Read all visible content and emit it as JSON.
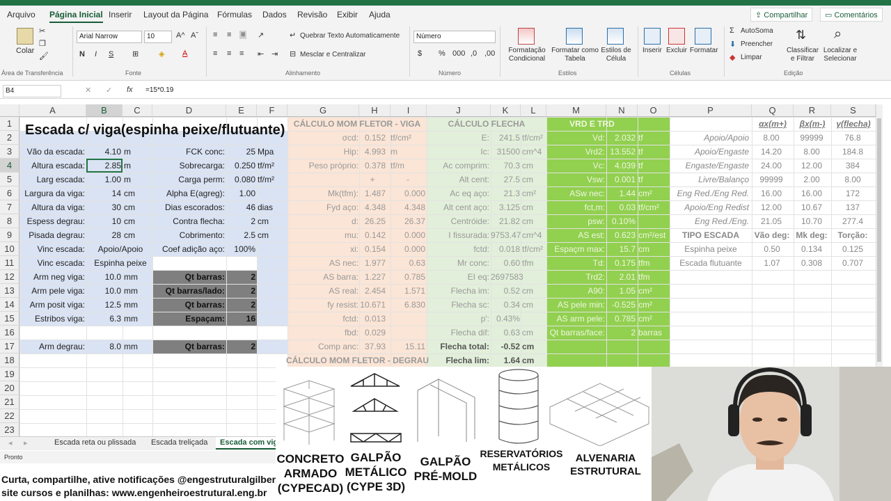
{
  "menu": {
    "items": [
      "Arquivo",
      "Página Inicial",
      "Inserir",
      "Layout da Página",
      "Fórmulas",
      "Dados",
      "Revisão",
      "Exibir",
      "Ajuda"
    ],
    "share": "Compartilhar",
    "comments": "Comentários"
  },
  "ribbon": {
    "paste": "Colar",
    "font_name": "Arial Narrow",
    "font_size": "10",
    "bold": "N",
    "italic": "I",
    "underline": "S",
    "wrap_text": "Quebrar Texto Automaticamente",
    "merge_center": "Mesclar e Centralizar",
    "number_format": "Número",
    "cond_format": "Formatação Condicional",
    "format_table": "Formatar como Tabela",
    "cell_styles": "Estilos de Célula",
    "insert": "Inserir",
    "delete": "Excluir",
    "format": "Formatar",
    "autosum": "AutoSoma",
    "fill": "Preencher",
    "clear": "Limpar",
    "sort_filter": "Classificar e Filtrar",
    "find_select": "Localizar e Selecionar",
    "groups": {
      "clipboard": "Área de Transferência",
      "font": "Fonte",
      "alignment": "Alinhamento",
      "number": "Número",
      "styles": "Estilos",
      "cells": "Células",
      "editing": "Edição"
    }
  },
  "formula_bar": {
    "name_box": "B4",
    "formula": "=15*0.19"
  },
  "columns": [
    "A",
    "B",
    "C",
    "D",
    "E",
    "F",
    "G",
    "H",
    "I",
    "J",
    "K",
    "L",
    "M",
    "N",
    "O",
    "P",
    "Q",
    "R",
    "S"
  ],
  "rows": [
    "1",
    "2",
    "3",
    "4",
    "5",
    "6",
    "7",
    "8",
    "9",
    "10",
    "11",
    "12",
    "13",
    "14",
    "15",
    "16",
    "17",
    "18",
    "19",
    "20",
    "21",
    "22",
    "23"
  ],
  "title": "Escada c/ viga(espinha peixe/flutuante)",
  "left_params": [
    {
      "label": "Vão da escada:",
      "value": "4.10",
      "unit": "m"
    },
    {
      "label": "Altura escada:",
      "value": "2.85",
      "unit": "m"
    },
    {
      "label": "Larg escada:",
      "value": "1.00",
      "unit": "m"
    },
    {
      "label": "Largura da viga:",
      "value": "14",
      "unit": "cm"
    },
    {
      "label": "Altura da viga:",
      "value": "30",
      "unit": "cm"
    },
    {
      "label": "Espess degrau:",
      "value": "10",
      "unit": "cm"
    },
    {
      "label": "Pisada degrau:",
      "value": "28",
      "unit": "cm"
    },
    {
      "label": "Vinc escada:",
      "value": "Apoio/Apoio",
      "unit": ""
    },
    {
      "label": "Vinc escada:",
      "value": "Espinha peixe",
      "unit": ""
    },
    {
      "label": "Arm neg viga:",
      "value": "10.0",
      "unit": "mm"
    },
    {
      "label": "Arm pele viga:",
      "value": "10.0",
      "unit": "mm"
    },
    {
      "label": "Arm posit viga:",
      "value": "12.5",
      "unit": "mm"
    },
    {
      "label": "Estribos viga:",
      "value": "6.3",
      "unit": "mm"
    },
    {
      "label": "",
      "value": "",
      "unit": ""
    },
    {
      "label": "Arm degrau:",
      "value": "8.0",
      "unit": "mm"
    }
  ],
  "mid_params": [
    {
      "label": "FCK conc:",
      "value": "25",
      "unit": "Mpa"
    },
    {
      "label": "Sobrecarga:",
      "value": "0.250",
      "unit": "tf/m²"
    },
    {
      "label": "Carga perm:",
      "value": "0.080",
      "unit": "tf/m²"
    },
    {
      "label": "Alpha E(agreg):",
      "value": "1.00",
      "unit": ""
    },
    {
      "label": "Dias escorados:",
      "value": "46",
      "unit": "dias"
    },
    {
      "label": "Contra flecha:",
      "value": "2",
      "unit": "cm"
    },
    {
      "label": "Cobrimento:",
      "value": "2.5",
      "unit": "cm"
    },
    {
      "label": "Coef adição aço:",
      "value": "100%",
      "unit": ""
    }
  ],
  "qt_rows": [
    {
      "row": 12,
      "label": "Qt barras:",
      "value": "2"
    },
    {
      "row": 13,
      "label": "Qt barras/lado:",
      "value": "2"
    },
    {
      "row": 14,
      "label": "Qt barras:",
      "value": "2"
    },
    {
      "row": 15,
      "label": "Espaçam:",
      "value": "16"
    },
    {
      "row": 17,
      "label": "Qt barras:",
      "value": "2"
    }
  ],
  "viga": {
    "header": "CÁLCULO MOM FLETOR - VIGA",
    "rows": [
      {
        "label": "σcd:",
        "v1": "0.152",
        "v2": "tf/cm²"
      },
      {
        "label": "Hip:",
        "v1": "4.993",
        "v2": "m"
      },
      {
        "label": "Peso próprio:",
        "v1": "0.378",
        "v2": "tf/m"
      },
      {
        "label": "",
        "v1": "+",
        "v2": "-"
      },
      {
        "label": "Mk(tfm):",
        "v1": "1.487",
        "v2": "0.000"
      },
      {
        "label": "Fyd aço:",
        "v1": "4.348",
        "v2": "4.348"
      },
      {
        "label": "d:",
        "v1": "26.25",
        "v2": "26.37"
      },
      {
        "label": "mu:",
        "v1": "0.142",
        "v2": "0.000"
      },
      {
        "label": "xi:",
        "v1": "0.154",
        "v2": "0.000"
      },
      {
        "label": "AS nec:",
        "v1": "1.977",
        "v2": "0.63"
      },
      {
        "label": "AS barra:",
        "v1": "1.227",
        "v2": "0.785"
      },
      {
        "label": "AS real:",
        "v1": "2.454",
        "v2": "1.571"
      },
      {
        "label": "fy resist:",
        "v1": "10.671",
        "v2": "6.830"
      },
      {
        "label": "fctd:",
        "v1": "0.013",
        "v2": ""
      },
      {
        "label": "fbd:",
        "v1": "0.029",
        "v2": ""
      },
      {
        "label": "Comp anc:",
        "v1": "37.93",
        "v2": "15.11"
      }
    ],
    "footer": "CÁLCULO MOM FLETOR - DEGRAU"
  },
  "flecha": {
    "header": "CÁLCULO FLECHA",
    "rows": [
      {
        "label": "E:",
        "value": "241.5",
        "unit": "tf/cm²"
      },
      {
        "label": "Ic:",
        "value": "31500",
        "unit": "cm^4"
      },
      {
        "label": "Ac comprim:",
        "value": "70.3",
        "unit": "cm"
      },
      {
        "label": "Alt cent:",
        "value": "27.5",
        "unit": "cm"
      },
      {
        "label": "Ac eq aço:",
        "value": "21.3",
        "unit": "cm²"
      },
      {
        "label": "Alt cent aço:",
        "value": "3.125",
        "unit": "cm"
      },
      {
        "label": "Centróide:",
        "value": "21.82",
        "unit": "cm"
      },
      {
        "label": "I fissurada:",
        "value": "9753.47",
        "unit": "cm^4"
      },
      {
        "label": "fctd:",
        "value": "0.018",
        "unit": "tf/cm²"
      },
      {
        "label": "Mr conc:",
        "value": "0.60",
        "unit": "tfm"
      },
      {
        "label": "EI eq:",
        "value": "2697583",
        "unit": ""
      },
      {
        "label": "Flecha im:",
        "value": "0.52",
        "unit": "cm"
      },
      {
        "label": "Flecha sc:",
        "value": "0.34",
        "unit": "cm"
      },
      {
        "label": "p':",
        "value": "0.43%",
        "unit": ""
      },
      {
        "label": "Flecha dif:",
        "value": "0.63",
        "unit": "cm"
      },
      {
        "label": "Flecha total:",
        "value": "-0.52",
        "unit": "cm"
      },
      {
        "label": "Flecha lim:",
        "value": "1.64",
        "unit": "cm"
      }
    ]
  },
  "vrd": {
    "header": "VRD E TRD",
    "rows": [
      {
        "label": "Vd:",
        "value": "2.032",
        "unit": "tf"
      },
      {
        "label": "Vrd2:",
        "value": "13.552",
        "unit": "tf"
      },
      {
        "label": "Vc:",
        "value": "4.039",
        "unit": "tf"
      },
      {
        "label": "Vsw:",
        "value": "0.001",
        "unit": "tf"
      },
      {
        "label": "ASw nec:",
        "value": "1.44",
        "unit": "cm²"
      },
      {
        "label": "fct,m:",
        "value": "0.03",
        "unit": "tf/cm²"
      },
      {
        "label": "psw:",
        "value": "0.10%",
        "unit": ""
      },
      {
        "label": "AS est:",
        "value": "0.623",
        "unit": "cm²/est"
      },
      {
        "label": "Espaçm max:",
        "value": "15.7",
        "unit": "cm"
      },
      {
        "label": "Td:",
        "value": "0.175",
        "unit": "tfm"
      },
      {
        "label": "Trd2:",
        "value": "2.01",
        "unit": "tfm"
      },
      {
        "label": "A90:",
        "value": "1.05",
        "unit": "cm²"
      },
      {
        "label": "AS pele min:",
        "value": "-0.525",
        "unit": "cm²"
      },
      {
        "label": "AS arm pele:",
        "value": "0.785",
        "unit": "cm²"
      },
      {
        "label": "Qt barras/face:",
        "value": "2",
        "unit": "barras"
      }
    ]
  },
  "coef": {
    "headers": [
      "αx(m+)",
      "βx(m-)",
      "γ(flecha)"
    ],
    "rows": [
      {
        "label": "Apoio/Apoio",
        "q": "8.00",
        "r": "99999",
        "s": "76.8"
      },
      {
        "label": "Apoio/Engaste",
        "q": "14.20",
        "r": "8.00",
        "s": "184.8"
      },
      {
        "label": "Engaste/Engaste",
        "q": "24.00",
        "r": "12.00",
        "s": "384"
      },
      {
        "label": "Livre/Balanço",
        "q": "99999",
        "r": "2.00",
        "s": "8.00"
      },
      {
        "label": "Eng Red./Eng Red.",
        "q": "16.00",
        "r": "16.00",
        "s": "172"
      },
      {
        "label": "Apoio/Eng Redist",
        "q": "12.00",
        "r": "10.67",
        "s": "137"
      },
      {
        "label": "Eng Red./Eng.",
        "q": "21.05",
        "r": "10.70",
        "s": "277.4"
      }
    ],
    "tipo": {
      "label": "TIPO ESCADA",
      "h1": "Vão deg:",
      "h2": "Mk deg:",
      "h3": "Torção:",
      "rows": [
        {
          "label": "Espinha peixe",
          "q": "0.50",
          "r": "0.134",
          "s": "0.125"
        },
        {
          "label": "Escada flutuante",
          "q": "1.07",
          "r": "0.308",
          "s": "0.707"
        }
      ]
    }
  },
  "sheet_tabs": [
    "Escada reta ou plissada",
    "Escada treliçada",
    "Escada com vig"
  ],
  "status": "Pronto",
  "footer": {
    "line1": "Curta, compartilhe, ative notificações @engestruturalgilberto",
    "line2": "site cursos e planilhas: www.engenheiroestrutural.eng.br"
  },
  "overlay": {
    "items": [
      "CONCRETO\nARMADO\n(CYPECAD)",
      "GALPÃO\nMETÁLICO\n(CYPE 3D)",
      "GALPÃO\nPRÉ-MOLD",
      "RESERVATÓRIOS\nMETÁLICOS",
      "ALVENARIA\nESTRUTURAL"
    ]
  },
  "colors": {
    "excel_green": "#217346",
    "viga_bg": "#fbe5d6",
    "flecha_bg": "#e2efda",
    "vrd_bg": "#92d050",
    "input_bg": "#dae3f3",
    "dark_bg": "#7f7f7f"
  }
}
